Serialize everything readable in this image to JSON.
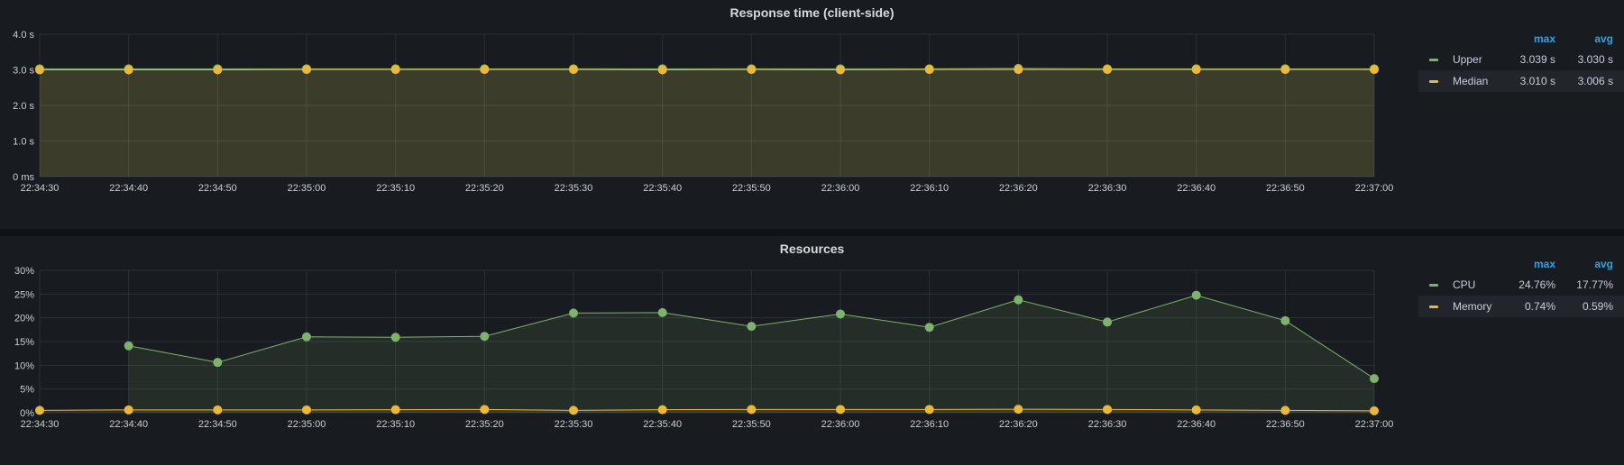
{
  "colors": {
    "upper": "#7eb26d",
    "median": "#eab839",
    "cpu": "#7eb26d",
    "memory": "#eab839",
    "legend_header": "#33a2e5"
  },
  "panels": {
    "response": {
      "title": "Response time (client-side)",
      "legend": {
        "headers": {
          "max": "max",
          "avg": "avg"
        },
        "rows": [
          {
            "name": "Upper",
            "max": "3.039 s",
            "avg": "3.030 s"
          },
          {
            "name": "Median",
            "max": "3.010 s",
            "avg": "3.006 s"
          }
        ]
      }
    },
    "resources": {
      "title": "Resources",
      "legend": {
        "headers": {
          "max": "max",
          "avg": "avg"
        },
        "rows": [
          {
            "name": "CPU",
            "max": "24.76%",
            "avg": "17.77%"
          },
          {
            "name": "Memory",
            "max": "0.74%",
            "avg": "0.59%"
          }
        ]
      }
    }
  },
  "chart_data": [
    {
      "type": "area",
      "title": "Response time (client-side)",
      "x": [
        "22:34:30",
        "22:34:40",
        "22:34:50",
        "22:35:00",
        "22:35:10",
        "22:35:20",
        "22:35:30",
        "22:35:40",
        "22:35:50",
        "22:36:00",
        "22:36:10",
        "22:36:20",
        "22:36:30",
        "22:36:40",
        "22:36:50",
        "22:37:00"
      ],
      "yticks": [
        "0 ms",
        "1.0 s",
        "2.0 s",
        "3.0 s",
        "4.0 s"
      ],
      "ylim": [
        0,
        4
      ],
      "y_unit": "s",
      "grid": true,
      "legend_position": "right",
      "series": [
        {
          "name": "Upper",
          "color": "#7eb26d",
          "values": [
            3.03,
            3.03,
            3.03,
            3.03,
            3.03,
            3.03,
            3.03,
            3.03,
            3.03,
            3.03,
            3.03,
            3.04,
            3.03,
            3.03,
            3.03,
            3.03
          ]
        },
        {
          "name": "Median",
          "color": "#eab839",
          "values": [
            3.0,
            3.0,
            3.0,
            3.01,
            3.01,
            3.01,
            3.01,
            3.0,
            3.01,
            3.0,
            3.01,
            3.01,
            3.01,
            3.01,
            3.01,
            3.01
          ]
        }
      ]
    },
    {
      "type": "area",
      "title": "Resources",
      "x": [
        "22:34:30",
        "22:34:40",
        "22:34:50",
        "22:35:00",
        "22:35:10",
        "22:35:20",
        "22:35:30",
        "22:35:40",
        "22:35:50",
        "22:36:00",
        "22:36:10",
        "22:36:20",
        "22:36:30",
        "22:36:40",
        "22:36:50",
        "22:37:00"
      ],
      "yticks": [
        "0%",
        "5%",
        "10%",
        "15%",
        "20%",
        "25%",
        "30%"
      ],
      "ylim": [
        0,
        30
      ],
      "y_unit": "%",
      "grid": true,
      "legend_position": "right",
      "series": [
        {
          "name": "CPU",
          "color": "#7eb26d",
          "values": [
            null,
            14.1,
            10.6,
            16.0,
            15.9,
            16.1,
            21.0,
            21.1,
            18.2,
            20.8,
            18.0,
            23.8,
            19.1,
            24.76,
            19.4,
            7.2
          ]
        },
        {
          "name": "Memory",
          "color": "#eab839",
          "values": [
            0.5,
            0.6,
            0.6,
            0.6,
            0.65,
            0.7,
            0.5,
            0.65,
            0.7,
            0.7,
            0.7,
            0.74,
            0.7,
            0.6,
            0.5,
            0.4
          ]
        }
      ]
    }
  ]
}
